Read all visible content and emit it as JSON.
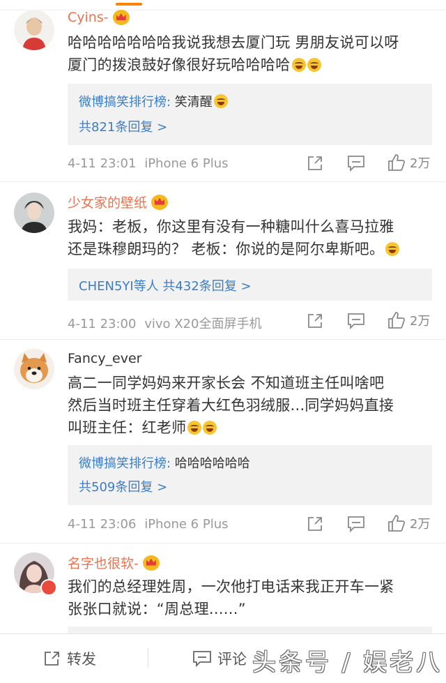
{
  "comments": [
    {
      "username": "Cyins-",
      "lines": [
        "哈哈哈哈哈哈哈我说我想去厦门玩 男朋友说可以呀",
        "厦门的拨浪鼓好像很好玩哈哈哈哈"
      ],
      "reply_name": "微博搞笑排行榜:",
      "reply_text": " 笑清醒",
      "reply_count": "共821条回复 >",
      "timestamp": "4-11 23:01",
      "device": "iPhone 6 Plus",
      "likes": "2万"
    },
    {
      "username": "少女家的壁纸",
      "lines": [
        "我妈：老板，你这里有没有一种糖叫什么喜马拉雅",
        "还是珠穆朗玛的？ 老板：你说的是阿尔卑斯吧。"
      ],
      "reply_line": "CHEN5YI等人 共432条回复 >",
      "timestamp": "4-11 23:00",
      "device": "vivo X20全面屏手机",
      "likes": "2万"
    },
    {
      "username": "Fancy_ever",
      "lines": [
        "高二一同学妈妈来开家长会 不知道班主任叫啥吧",
        "然后当时班主任穿着大红色羽绒服...同学妈妈直接",
        "叫班主任：红老师"
      ],
      "reply_name": "微博搞笑排行榜:",
      "reply_text": " 哈哈哈哈哈哈",
      "reply_count": "共509条回复 >",
      "timestamp": "4-11 23:06",
      "device": "iPhone 6 Plus",
      "likes": "2万"
    },
    {
      "username": "名字也很软-",
      "lines": [
        "我们的总经理姓周，一次他打电话来我正开车一紧",
        "张张口就说：“周总理......”"
      ]
    }
  ],
  "bottom_bar": {
    "repost_label": "转发",
    "comment_label": "评论"
  },
  "watermark": "头条号 / 娱老八",
  "colors": {
    "vip_name": "#eb7350",
    "link": "#3b7dc4",
    "reply_bg": "#f2f2f2",
    "meta": "#999999"
  }
}
